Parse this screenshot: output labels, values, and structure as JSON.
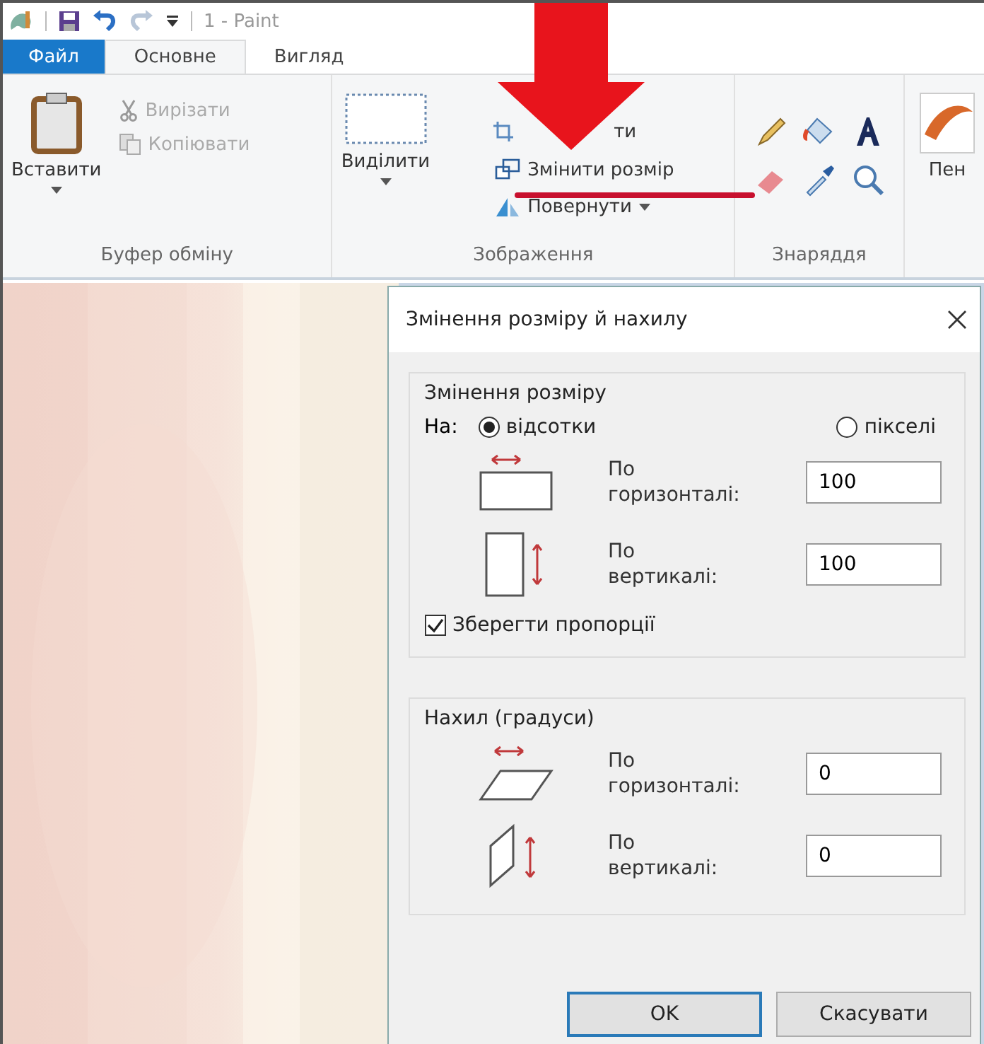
{
  "window": {
    "title": "1 - Paint"
  },
  "tabs": [
    {
      "label": "Файл",
      "kind": "file",
      "selected": false
    },
    {
      "label": "Основне",
      "kind": "tab",
      "selected": true
    },
    {
      "label": "Вигляд",
      "kind": "tab",
      "selected": false
    }
  ],
  "ribbon": {
    "clipboard": {
      "label": "Буфер обміну",
      "paste": "Вставити",
      "items": [
        {
          "kind": "cut",
          "label": "Вирізати",
          "disabled": true
        },
        {
          "kind": "copy",
          "label": "Копіювати",
          "disabled": true
        }
      ]
    },
    "image": {
      "label": "Зображення",
      "select": "Виділити",
      "items": [
        {
          "kind": "crop",
          "label": "ти"
        },
        {
          "kind": "resize",
          "label": "Змінити розмір",
          "underlined": true
        },
        {
          "kind": "rotate",
          "label": "Повернути"
        }
      ]
    },
    "tools": {
      "label": "Знаряддя"
    },
    "brushes": {
      "label": "Пен"
    }
  },
  "dialog": {
    "title": "Змінення розміру й нахилу",
    "resize": {
      "legend": "Змінення розміру",
      "by_label": "На:",
      "radios": [
        {
          "label": "відсотки",
          "selected": true
        },
        {
          "label": "пікселі",
          "selected": false
        }
      ],
      "fields": [
        {
          "kind": "horizontal",
          "label": "По горизонталі:",
          "value": "100"
        },
        {
          "kind": "vertical",
          "label": "По вертикалі:",
          "value": "100"
        }
      ],
      "keep_ratio": {
        "label": "Зберегти пропорції",
        "checked": true
      }
    },
    "skew": {
      "legend": "Нахил (градуси)",
      "fields": [
        {
          "kind": "skew-horizontal",
          "label": "По горизонталі:",
          "value": "0"
        },
        {
          "kind": "skew-vertical",
          "label": "По вертикалі:",
          "value": "0"
        }
      ]
    },
    "buttons": [
      {
        "label": "OK",
        "kind": "default"
      },
      {
        "label": "Скасувати",
        "kind": "normal"
      }
    ]
  }
}
